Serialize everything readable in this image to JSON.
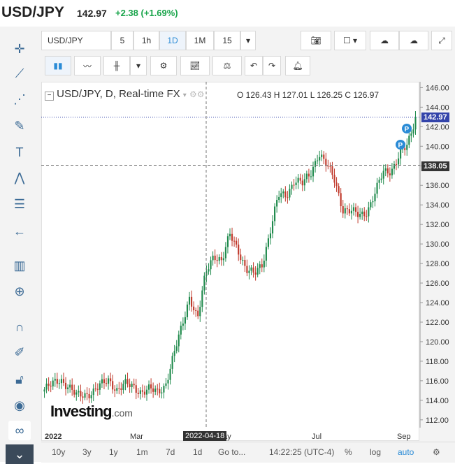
{
  "header": {
    "symbol": "USD/JPY",
    "price": "142.97",
    "change": "+2.38 (+1.69%)"
  },
  "toolbar": {
    "symbol_input": "USD/JPY",
    "intervals": [
      "5",
      "1h",
      "1D",
      "1M",
      "15"
    ],
    "active_interval": "1D"
  },
  "legend": {
    "title": "USD/JPY, D, Real-time FX",
    "ohlc": "O 126.43  H 127.01  L 126.25  C 126.97"
  },
  "price_tags": {
    "last": "142.97",
    "cursor": "138.05"
  },
  "crosshair_date": "2022-04-18",
  "logo": {
    "main": "Investing",
    "suffix": ".com"
  },
  "bottom": {
    "ranges": [
      "10y",
      "3y",
      "1y",
      "1m",
      "7d",
      "1d"
    ],
    "goto": "Go to...",
    "time": "14:22:25 (UTC-4)",
    "pct": "%",
    "log": "log",
    "auto": "auto"
  },
  "colors": {
    "up": "#1f8a4c",
    "down": "#c0392b",
    "accent": "#2a8bd6",
    "last_line": "#3344aa"
  },
  "chart_data": {
    "type": "candlestick",
    "title": "USD/JPY, D, Real-time FX",
    "x_ticks": [
      "2022",
      "Mar",
      "May",
      "Jul",
      "Sep"
    ],
    "y_ticks": [
      112,
      114,
      116,
      118,
      120,
      122,
      124,
      126,
      128,
      130,
      132,
      134,
      136,
      138,
      140,
      142,
      144,
      146
    ],
    "ylim": [
      111.2,
      146.6
    ],
    "grid": false,
    "series": [
      {
        "values": [
          115.1,
          115.6,
          116.2,
          115.4,
          114.4,
          114.6,
          114.9,
          115.5,
          116.1,
          115.1,
          115.6,
          115.4,
          114.9,
          115.1,
          114.8,
          115.6,
          118.5,
          121.4,
          124.7,
          122.3,
          127.0,
          129.0,
          128.2,
          130.9,
          129.5,
          127.4,
          126.8,
          128.0,
          131.4,
          134.9,
          135.0,
          136.6,
          136.1,
          137.2,
          139.4,
          138.0,
          136.5,
          133.6,
          133.3,
          132.9,
          133.4,
          135.2,
          137.3,
          137.6,
          139.1,
          140.0,
          142.97
        ]
      }
    ]
  }
}
